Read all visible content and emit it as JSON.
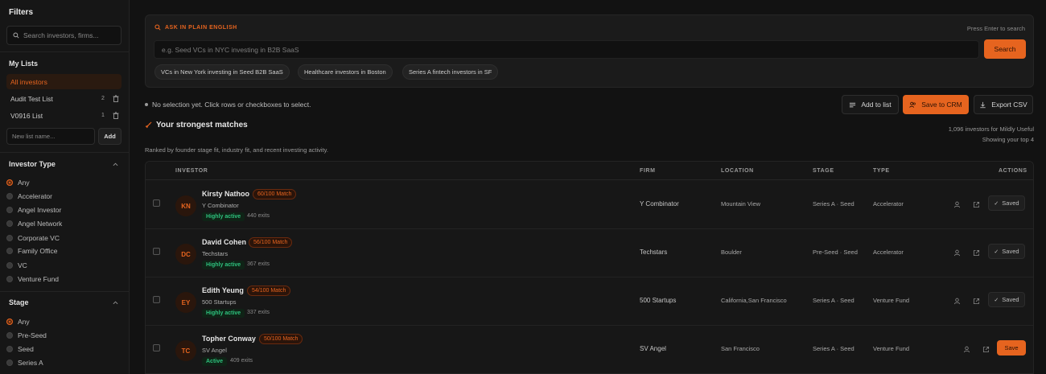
{
  "sidebar": {
    "title": "Filters",
    "search_placeholder": "Search investors, firms...",
    "my_lists_title": "My Lists",
    "lists": [
      {
        "label": "All investors",
        "count": ""
      },
      {
        "label": "Audit Test List",
        "count": "2"
      },
      {
        "label": "V0916 List",
        "count": "1"
      }
    ],
    "new_list_placeholder": "New list name...",
    "add_label": "Add",
    "investor_type_title": "Investor Type",
    "investor_types": [
      "Any",
      "Accelerator",
      "Angel Investor",
      "Angel Network",
      "Corporate VC",
      "Family Office",
      "VC",
      "Venture Fund"
    ],
    "stage_title": "Stage",
    "stages": [
      "Any",
      "Pre-Seed",
      "Seed",
      "Series A"
    ]
  },
  "ask": {
    "label": "ASK IN PLAIN ENGLISH",
    "hint": "Press Enter to search",
    "placeholder": "e.g. Seed VCs in NYC investing in B2B SaaS",
    "search_label": "Search",
    "chips": [
      "VCs in New York investing in Seed B2B SaaS",
      "Healthcare investors in Boston",
      "Series A fintech investors in SF"
    ]
  },
  "toolbar": {
    "selection_note": "No selection yet. Click rows or checkboxes to select.",
    "add_to_list": "Add to list",
    "save_to_crm": "Save to CRM",
    "export_csv": "Export CSV"
  },
  "matches": {
    "title": "Your strongest matches",
    "subtitle": "Ranked by founder stage fit, industry fit, and recent investing activity.",
    "count_line1": "1,096 investors for Mildly Useful",
    "count_line2": "Showing your top 4"
  },
  "table": {
    "headers": {
      "investor": "INVESTOR",
      "firm": "FIRM",
      "location": "LOCATION",
      "stage": "STAGE",
      "type": "TYPE",
      "actions": "ACTIONS"
    },
    "rows": [
      {
        "initials": "KN",
        "name": "Kirsty Nathoo",
        "match": "60/100 Match",
        "firm": "Y Combinator",
        "activity": "Highly active",
        "exits": "440 exits",
        "firm_col": "Y Combinator",
        "location": "Mountain View",
        "stage": "Series A · Seed",
        "type": "Accelerator",
        "action": "Saved"
      },
      {
        "initials": "DC",
        "name": "David Cohen",
        "match": "56/100 Match",
        "firm": "Techstars",
        "activity": "Highly active",
        "exits": "367 exits",
        "firm_col": "Techstars",
        "location": "Boulder",
        "stage": "Pre-Seed · Seed",
        "type": "Accelerator",
        "action": "Saved"
      },
      {
        "initials": "EY",
        "name": "Edith Yeung",
        "match": "54/100 Match",
        "firm": "500 Startups",
        "activity": "Highly active",
        "exits": "337 exits",
        "firm_col": "500 Startups",
        "location": "California,San Francisco",
        "stage": "Series A · Seed",
        "type": "Venture Fund",
        "action": "Saved"
      },
      {
        "initials": "TC",
        "name": "Topher Conway",
        "match": "50/100 Match",
        "firm": "SV Angel",
        "activity": "Active",
        "exits": "409 exits",
        "firm_col": "SV Angel",
        "location": "San Francisco",
        "stage": "Series A · Seed",
        "type": "Venture Fund",
        "action": "Save"
      }
    ]
  },
  "colors": {
    "accent": "#e6641f",
    "active_green": "#2ec27e",
    "background": "#121212"
  }
}
